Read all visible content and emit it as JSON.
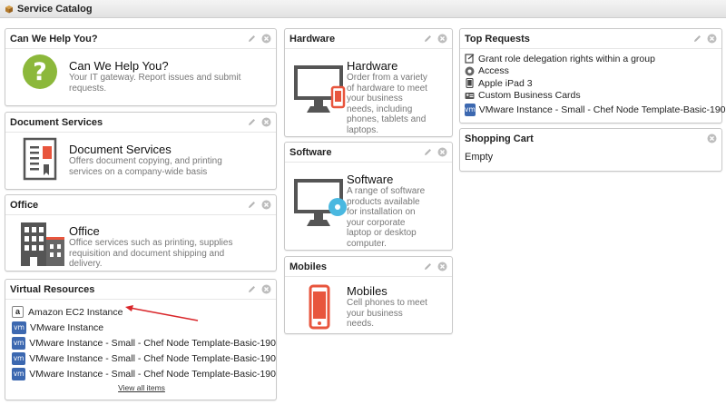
{
  "header": {
    "title": "Service Catalog",
    "icon": "box-icon"
  },
  "widgets": {
    "help": {
      "header": "Can We Help You?",
      "title": "Can We Help You?",
      "desc_lines": [
        "Your IT gateway. Report issues and submit",
        "requests."
      ],
      "icon": "question-mark-icon",
      "color": "#8cb83b"
    },
    "docs": {
      "header": "Document Services",
      "title": "Document Services",
      "desc_lines": [
        "Offers document copying, and printing",
        "services on a company-wide basis"
      ],
      "icon": "certificate-icon"
    },
    "office": {
      "header": "Office",
      "title": "Office",
      "desc_lines": [
        "Office services such as printing, supplies",
        "requisition and document shipping and",
        "delivery."
      ],
      "icon": "office-building-icon"
    },
    "virtual": {
      "header": "Virtual Resources",
      "items": [
        {
          "label": "Amazon EC2 Instance",
          "icon": "amazon-icon"
        },
        {
          "label": "VMware Instance",
          "icon": "vmware-icon"
        },
        {
          "label": "VMware Instance - Small - Chef Node Template-Basic-190",
          "icon": "vmware-icon"
        },
        {
          "label": "VMware Instance - Small - Chef Node Template-Basic-190",
          "icon": "vmware-icon"
        },
        {
          "label": "VMware Instance - Small - Chef Node Template-Basic-190",
          "icon": "vmware-icon"
        }
      ],
      "view_all": "View all items",
      "vm_badge": "vm",
      "amazon_badge": "a"
    },
    "hardware": {
      "header": "Hardware",
      "title": "Hardware",
      "desc_lines": [
        "Order from a variety",
        "of hardware to meet",
        "your business",
        "needs, including",
        "phones, tablets and",
        "laptops."
      ],
      "icon": "monitor-phone-icon"
    },
    "software": {
      "header": "Software",
      "title": "Software",
      "desc_lines": [
        "A range of software",
        "products available",
        "for installation on",
        "your corporate",
        "laptop or desktop",
        "computer."
      ],
      "icon": "monitor-disc-icon"
    },
    "mobiles": {
      "header": "Mobiles",
      "title": "Mobiles",
      "desc_lines": [
        "Cell phones to meet",
        "your business",
        "needs."
      ],
      "icon": "mobile-phone-icon"
    },
    "top": {
      "header": "Top Requests",
      "items": [
        {
          "label": "Grant role delegation rights within a group",
          "icon": "delegation-icon"
        },
        {
          "label": "Access",
          "icon": "access-icon"
        },
        {
          "label": "Apple iPad 3",
          "icon": "ipad-icon"
        },
        {
          "label": "Custom Business Cards",
          "icon": "business-card-icon"
        },
        {
          "label": "VMware Instance - Small - Chef Node Template-Basic-190",
          "icon": "vmware-icon"
        }
      ]
    },
    "cart": {
      "header": "Shopping Cart",
      "status": "Empty"
    }
  },
  "colors": {
    "accent_orange": "#e8553d",
    "accent_blue": "#4ab8e0",
    "vm_blue": "#3c68b0",
    "green": "#8cb83b",
    "annotation_red": "#d9262a"
  }
}
